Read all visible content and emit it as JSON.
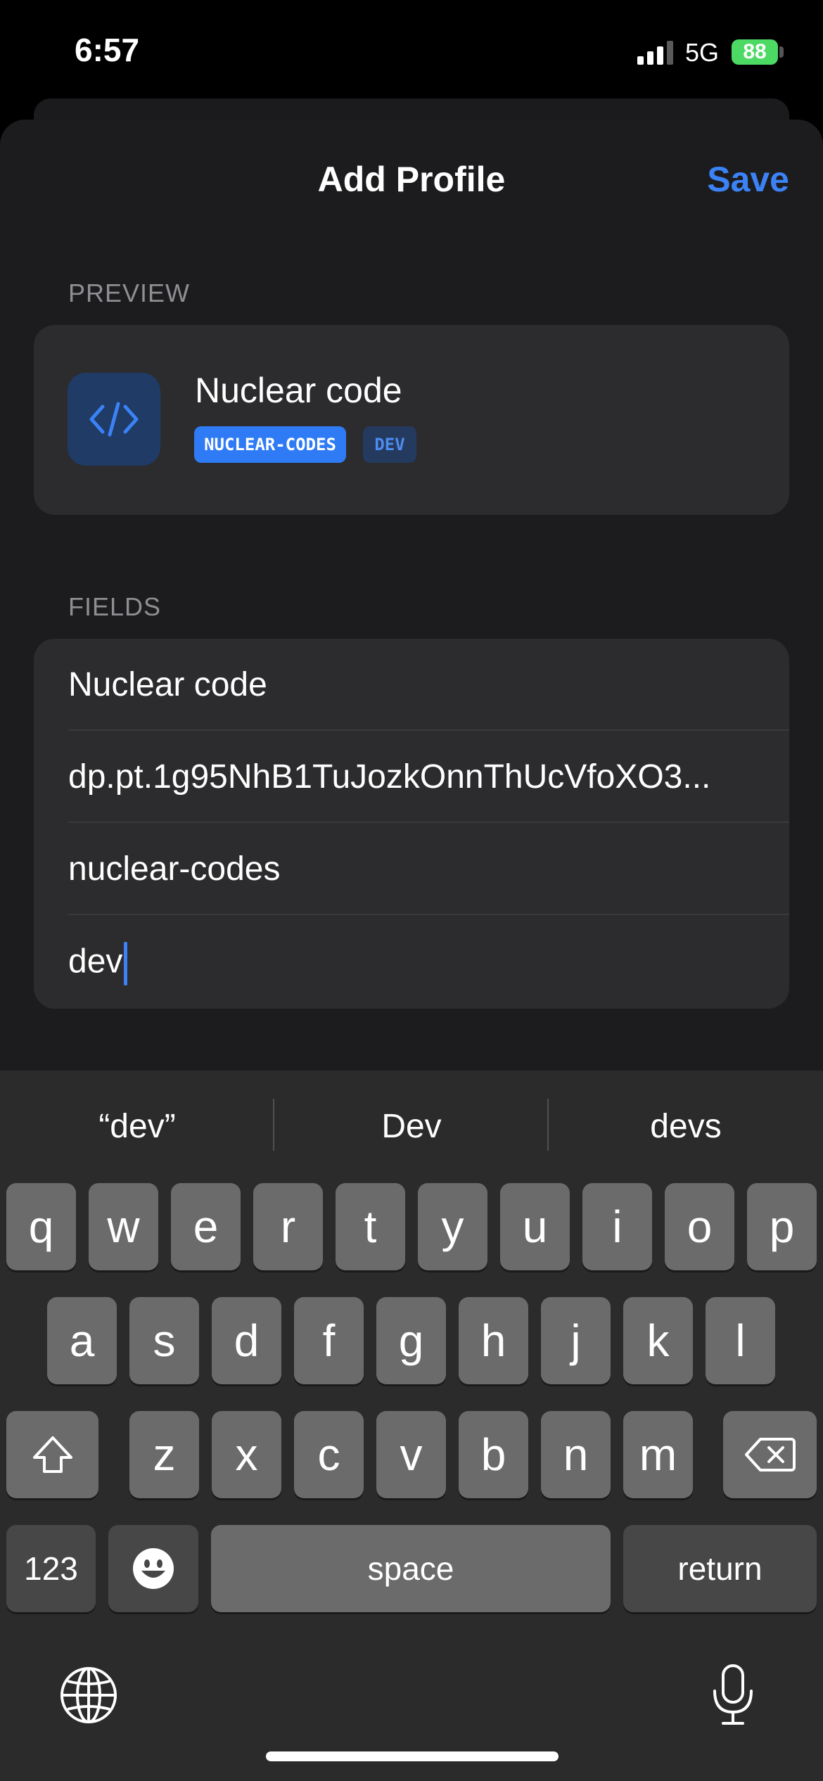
{
  "status_bar": {
    "time": "6:57",
    "network": "5G",
    "battery": "88"
  },
  "header": {
    "title": "Add Profile",
    "save_label": "Save"
  },
  "preview": {
    "section_label": "PREVIEW",
    "name": "Nuclear code",
    "tags": [
      "NUCLEAR-CODES",
      "DEV"
    ],
    "icon": "code-icon"
  },
  "fields": {
    "section_label": "FIELDS",
    "values": [
      "Nuclear code",
      "dp.pt.1g95NhB1TuJozkOnnThUcVfoXO3...",
      "nuclear-codes",
      "dev"
    ]
  },
  "keyboard": {
    "suggestions": [
      "“dev”",
      "Dev",
      "devs"
    ],
    "row1": [
      "q",
      "w",
      "e",
      "r",
      "t",
      "y",
      "u",
      "i",
      "o",
      "p"
    ],
    "row2": [
      "a",
      "s",
      "d",
      "f",
      "g",
      "h",
      "j",
      "k",
      "l"
    ],
    "row3": [
      "z",
      "x",
      "c",
      "v",
      "b",
      "n",
      "m"
    ],
    "numbers_label": "123",
    "space_label": "space",
    "return_label": "return"
  },
  "colors": {
    "accent": "#3b82f6",
    "tag_primary": "#2f7bf5",
    "battery": "#4cd964"
  }
}
